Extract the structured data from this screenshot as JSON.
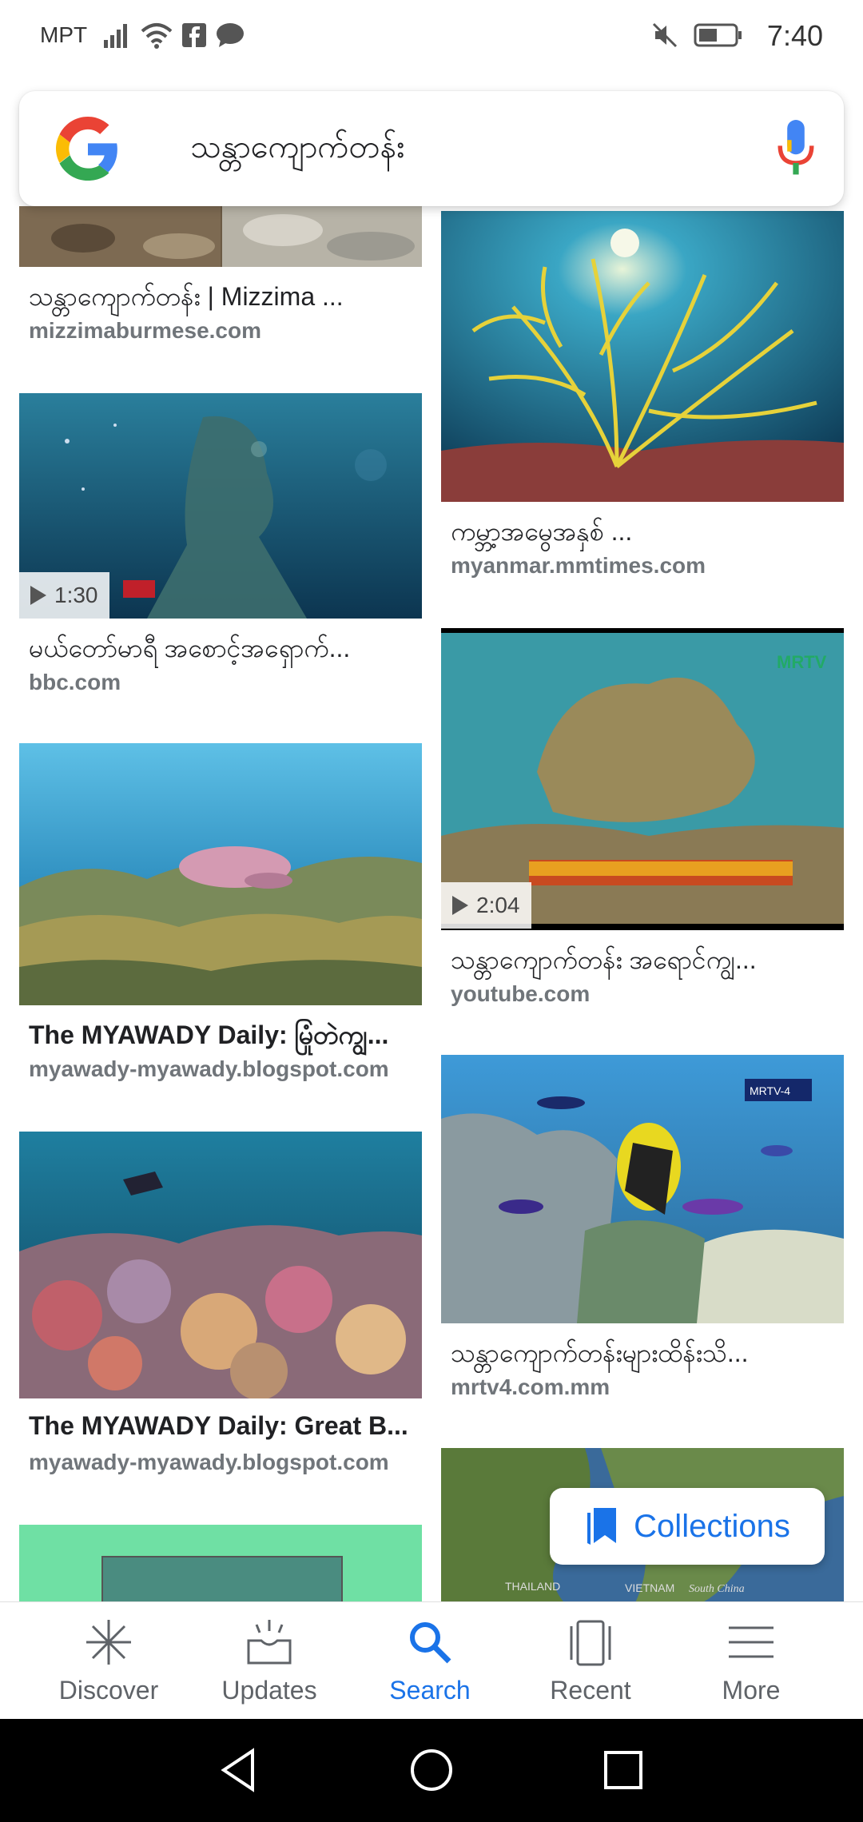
{
  "status_bar": {
    "carrier": "MPT",
    "time": "7:40"
  },
  "search": {
    "query": "သန္တာကျောက်တန်း"
  },
  "results": [
    {
      "title": "သန္တာကျောက်တန်း | Mizzima ...",
      "source": "mizzimaburmese.com"
    },
    {
      "title": "ကမ္ဘာ့အမွေအနှစ် ...",
      "source": "myanmar.mmtimes.com"
    },
    {
      "title": "မယ်တော်မာရီ အစောင့်အရှောက်...",
      "source": "bbc.com",
      "duration": "1:30"
    },
    {
      "title": "သန္တာကျောက်တန်း အရောင်ကျွ...",
      "source": "youtube.com",
      "duration": "2:04"
    },
    {
      "title": "The MYAWADY Daily: မြုံတဲကျွ...",
      "source": "myawady-myawady.blogspot.com"
    },
    {
      "title": "သန္တာကျောက်တန်းများထိန်းသိ...",
      "source": "mrtv4.com.mm"
    },
    {
      "title": "The MYAWADY Daily: Great B...",
      "source": "myawady-myawady.blogspot.com"
    }
  ],
  "collections_label": "Collections",
  "nav": [
    {
      "label": "Discover",
      "icon": "asterisk-icon"
    },
    {
      "label": "Updates",
      "icon": "updates-icon"
    },
    {
      "label": "Search",
      "icon": "search-icon"
    },
    {
      "label": "Recent",
      "icon": "recent-icon"
    },
    {
      "label": "More",
      "icon": "menu-icon"
    }
  ],
  "colors": {
    "accent": "#1a73e8",
    "text": "#202124",
    "muted": "#70757a"
  }
}
